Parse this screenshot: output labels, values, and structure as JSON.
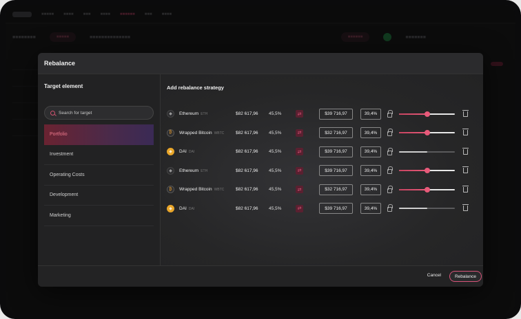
{
  "modal": {
    "title": "Rebalance",
    "left_title": "Target element",
    "search_placeholder": "Search for target",
    "targets": [
      {
        "label": "Portfolio",
        "active": true
      },
      {
        "label": "Investment",
        "active": false
      },
      {
        "label": "Operating Costs",
        "active": false
      },
      {
        "label": "Development",
        "active": false
      },
      {
        "label": "Marketing",
        "active": false
      }
    ],
    "right_title": "Add rebalance strategy",
    "rows": [
      {
        "coin": "eth",
        "name": "Ethereum",
        "ticker": "ETH",
        "amount": "$82 617,96",
        "pct": "45,5%",
        "target_value": "$39 716,97",
        "target_pct": "39,4%",
        "slider": 0.5,
        "style": "pink"
      },
      {
        "coin": "wbtc",
        "name": "Wrapped Bitcoin",
        "ticker": "WBTC",
        "amount": "$82 617,96",
        "pct": "45,5%",
        "target_value": "$32 716,97",
        "target_pct": "39,4%",
        "slider": 0.5,
        "style": "pink"
      },
      {
        "coin": "dai",
        "name": "DAI",
        "ticker": "DAI",
        "amount": "$82 617,96",
        "pct": "45,5%",
        "target_value": "$39 716,97",
        "target_pct": "39,4%",
        "slider": 0.5,
        "style": "grey"
      },
      {
        "coin": "eth",
        "name": "Ethereum",
        "ticker": "ETH",
        "amount": "$82 617,96",
        "pct": "45,5%",
        "target_value": "$39 716,97",
        "target_pct": "39,4%",
        "slider": 0.5,
        "style": "pink"
      },
      {
        "coin": "wbtc",
        "name": "Wrapped Bitcoin",
        "ticker": "WBTC",
        "amount": "$82 617,96",
        "pct": "45,5%",
        "target_value": "$32 716,97",
        "target_pct": "39,4%",
        "slider": 0.5,
        "style": "pink"
      },
      {
        "coin": "dai",
        "name": "DAI",
        "ticker": "DAI",
        "amount": "$82 617,96",
        "pct": "45,5%",
        "target_value": "$39 716,97",
        "target_pct": "39,4%",
        "slider": 0.5,
        "style": "grey"
      }
    ],
    "cancel_label": "Cancel",
    "rebalance_label": "Rebalance"
  },
  "icons": {
    "eth": "ethereum-icon",
    "wbtc": "bitcoin-icon",
    "dai": "dai-icon",
    "swap": "swap-icon",
    "lock": "lock-icon",
    "trash": "trash-icon",
    "search": "search-icon"
  },
  "colors": {
    "accent": "#e85a7a",
    "active_target_text": "#f07a8e",
    "dai": "#e9a629",
    "wbtc": "#e39a2d"
  }
}
